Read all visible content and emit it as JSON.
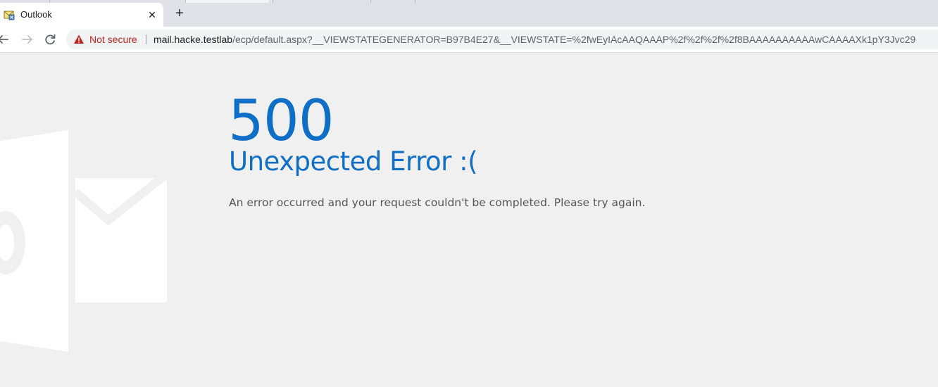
{
  "browser": {
    "tab": {
      "title": "Outlook",
      "favicon": "outlook-mail-icon",
      "close_glyph": "✕"
    },
    "new_tab_glyph": "+",
    "nav": {
      "back_icon": "back-arrow-icon",
      "forward_icon": "forward-arrow-icon",
      "reload_icon": "reload-icon"
    },
    "omnibox": {
      "security_icon": "warning-triangle-icon",
      "security_label": "Not secure",
      "security_color": "#c5221f",
      "url_host": "mail.hacke.testlab",
      "url_rest": "/ecp/default.aspx?__VIEWSTATEGENERATOR=B97B4E27&__VIEWSTATE=%2fwEyIAcAAQAAAP%2f%2f%2f%2f8BAAAAAAAAAAwCAAAAXk1pY3Jvc29"
    }
  },
  "page": {
    "background": "#f0f0f0",
    "accent_color": "#0f6fc6",
    "watermark_icon": "outlook-logo-watermark-icon",
    "error_code": "500",
    "error_title": "Unexpected Error :(",
    "error_message": "An error occurred and your request couldn't be completed. Please try again."
  }
}
